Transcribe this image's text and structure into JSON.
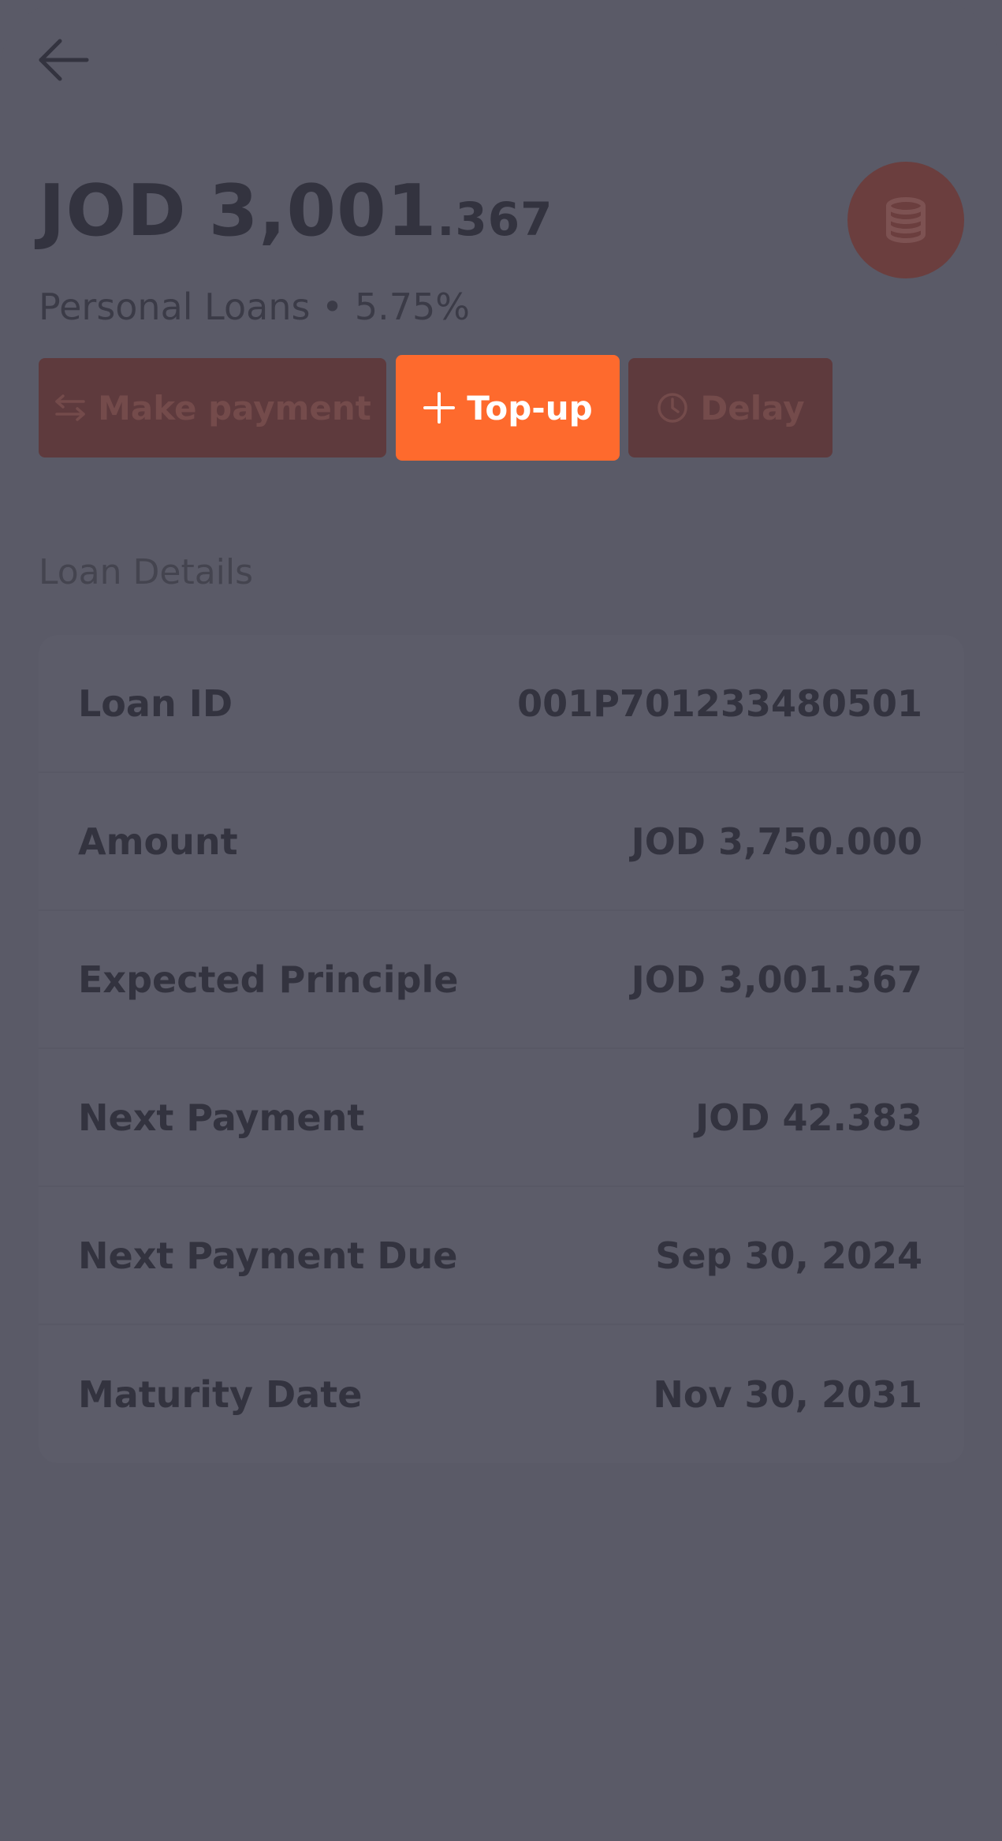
{
  "header": {
    "back_icon": "arrow-left-icon"
  },
  "balance": {
    "currency": "JOD",
    "integer": "3,001",
    "decimal": ".367"
  },
  "account_icon": "coins-stack-icon",
  "subtitle": "Personal Loans • 5.75%",
  "actions": {
    "make_payment": {
      "label": "Make payment",
      "icon": "transfer-arrows-icon"
    },
    "topup": {
      "label": "Top-up",
      "icon": "plus-icon"
    },
    "delay": {
      "label": "Delay",
      "icon": "clock-icon"
    }
  },
  "section": {
    "title": "Loan Details"
  },
  "details": [
    {
      "key": "Loan ID",
      "value": "001P701233480501"
    },
    {
      "key": "Amount",
      "value": "JOD 3,750.000"
    },
    {
      "key": "Expected Principle",
      "value": "JOD 3,001.367"
    },
    {
      "key": "Next Payment",
      "value": "JOD 42.383"
    },
    {
      "key": "Next Payment Due",
      "value": "Sep 30, 2024"
    },
    {
      "key": "Maturity Date",
      "value": "Nov 30, 2031"
    }
  ],
  "colors": {
    "overlay_background": "#5a5a67",
    "accent": "#fe6a2d",
    "muted_button": "#5e3a3d",
    "text_dark": "#33333f"
  }
}
